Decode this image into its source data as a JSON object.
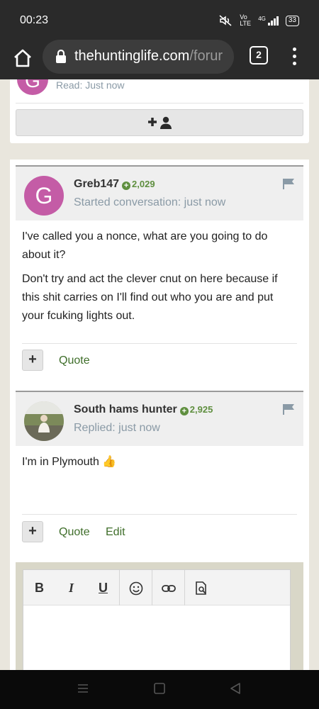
{
  "status_bar": {
    "time": "00:23",
    "network_label": "Vo LTE",
    "signal_label": "4G",
    "battery": "33"
  },
  "browser": {
    "url_domain": "thehuntinglife.com",
    "url_path": "/forur",
    "tab_count": "2"
  },
  "recipient_card": {
    "avatar_letter": "G",
    "read_status": "Read: Just now"
  },
  "messages": [
    {
      "username": "Greb147",
      "score": "2,029",
      "meta": "Started conversation: just now",
      "avatar_letter": "G",
      "paragraphs": [
        "I've called you a nonce, what are you going to do about it?",
        "Don't try and act the clever cnut on here because if this shit carries on I'll find out who you are and put your fcuking lights out."
      ],
      "actions": {
        "plus": "+",
        "quote": "Quote"
      }
    },
    {
      "username": "South hams hunter",
      "score": "2,925",
      "meta": "Replied: just now",
      "paragraphs": [
        "I'm in Plymouth 👍"
      ],
      "actions": {
        "plus": "+",
        "quote": "Quote",
        "edit": "Edit"
      }
    }
  ],
  "editor": {
    "bold": "B",
    "italic": "I",
    "underline": "U"
  },
  "colors": {
    "avatar": "#c45ca6",
    "score_green": "#5f8f3f",
    "link_green": "#3f6e2a",
    "meta_gray": "#8a9aa6"
  }
}
